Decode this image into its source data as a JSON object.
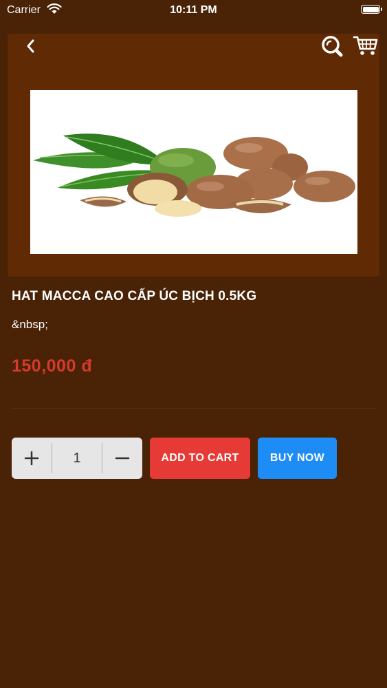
{
  "status_bar": {
    "carrier": "Carrier",
    "time": "10:11 PM"
  },
  "header": {
    "back_icon": "chevron-left-icon",
    "search_icon": "search-icon",
    "cart_icon": "cart-icon"
  },
  "product": {
    "title": "HAT MACCA CAO CẤP ÚC BỊCH 0.5KG",
    "description": "&nbsp;",
    "price": "150,000 đ",
    "image_alt": "macadamia nuts with green leaves"
  },
  "quantity": {
    "plus_icon": "plus-icon",
    "value": "1",
    "minus_icon": "minus-icon"
  },
  "actions": {
    "add_to_cart_label": "ADD TO CART",
    "buy_now_label": "BUY NOW"
  },
  "colors": {
    "background": "#4a2206",
    "card": "#602a04",
    "price": "#d53a2c",
    "add_to_cart": "#e53a35",
    "buy_now": "#1e8cf5"
  }
}
